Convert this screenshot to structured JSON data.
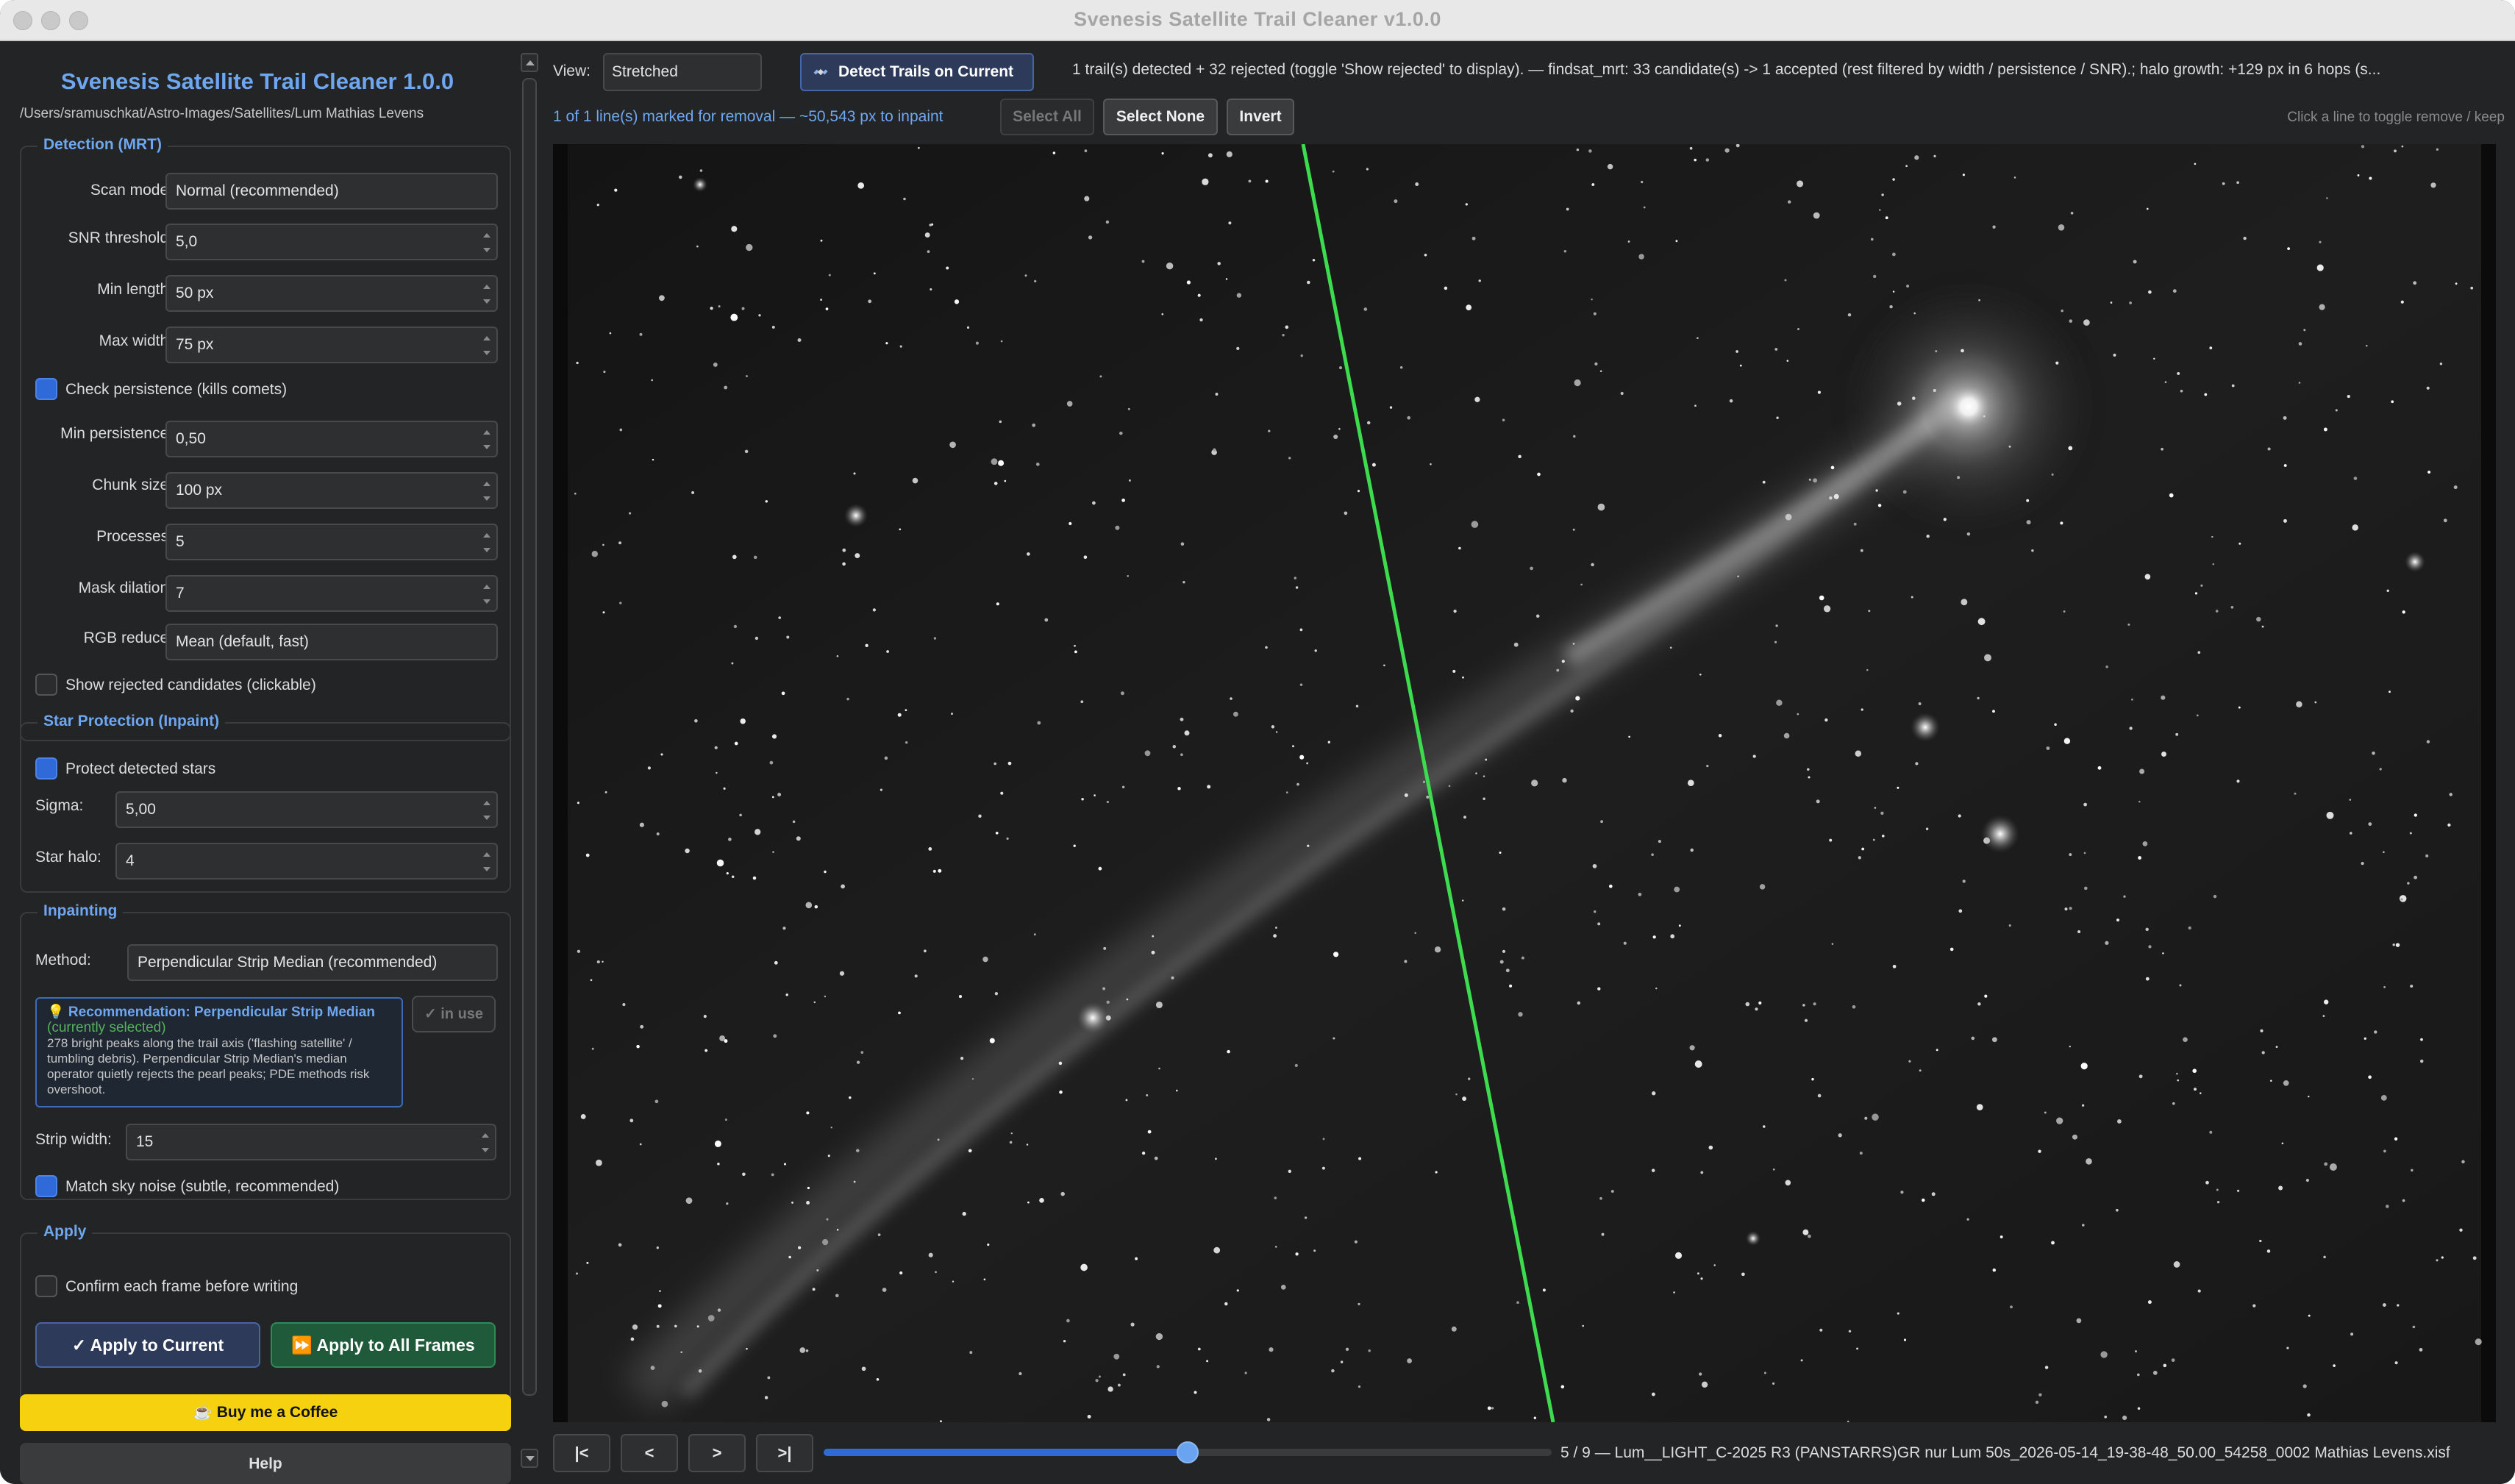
{
  "window": {
    "title": "Svenesis Satellite Trail Cleaner  v1.0.0"
  },
  "sidebar": {
    "app_title": "Svenesis Satellite Trail Cleaner 1.0.0",
    "path": "/Users/sramuschkat/Astro-Images/Satellites/Lum Mathias Levens",
    "detection": {
      "title": "Detection (MRT)",
      "scan_mode_label": "Scan mode:",
      "scan_mode_value": "Normal (recommended)",
      "snr_label": "SNR threshold:",
      "snr_value": "5,0",
      "min_length_label": "Min length:",
      "min_length_value": "50 px",
      "max_width_label": "Max width:",
      "max_width_value": "75 px",
      "persistence_check_label": "Check persistence (kills comets)",
      "persistence_checked": true,
      "min_persistence_label": "Min persistence:",
      "min_persistence_value": "0,50",
      "chunk_label": "Chunk size:",
      "chunk_value": "100 px",
      "processes_label": "Processes:",
      "processes_value": "5",
      "dilation_label": "Mask dilation:",
      "dilation_value": "7",
      "rgb_label": "RGB reduce:",
      "rgb_value": "Mean (default, fast)",
      "show_rejected_label": "Show rejected candidates (clickable)",
      "show_rejected_checked": false
    },
    "star": {
      "title": "Star Protection (Inpaint)",
      "protect_label": "Protect detected stars",
      "protect_checked": true,
      "sigma_label": "Sigma:",
      "sigma_value": "5,00",
      "halo_label": "Star halo:",
      "halo_value": "4"
    },
    "inpainting": {
      "title": "Inpainting",
      "method_label": "Method:",
      "method_value": "Perpendicular Strip Median (recommended)",
      "rec_title": "💡 Recommendation: Perpendicular Strip Median",
      "rec_sub": "(currently selected)",
      "rec_body": "278 bright peaks along the trail axis ('flashing satellite' / tumbling debris). Perpendicular Strip Median's median operator quietly rejects the pearl peaks; PDE methods risk overshoot.",
      "in_use_label": "✓ in use",
      "strip_label": "Strip width:",
      "strip_value": "15",
      "noise_label": "Match sky noise (subtle, recommended)",
      "noise_checked": true
    },
    "apply": {
      "title": "Apply",
      "confirm_label": "Confirm each frame before writing",
      "confirm_checked": false,
      "apply_current": "✓ Apply to Current",
      "apply_all": "⏩ Apply to All Frames"
    },
    "coffee_label": "☕ Buy me a Coffee",
    "help_label": "Help"
  },
  "toolbar": {
    "view_label": "View:",
    "view_value": "Stretched",
    "detect_label": "Detect Trails on Current",
    "status": "1 trail(s) detected  +  32 rejected (toggle 'Show rejected' to display).  —  findsat_mrt: 33 candidate(s) -> 1 accepted (rest filtered by width / persistence / SNR).; halo growth: +129 px in 6 hops (s...",
    "marked": "1 of 1 line(s) marked for removal  —  ~50,543 px to inpaint",
    "select_all": "Select All",
    "select_none": "Select None",
    "invert": "Invert",
    "hint": "Click a line to toggle remove / keep"
  },
  "navigator": {
    "first": "|<",
    "prev": "<",
    "next": ">",
    "last": ">|",
    "frame_index": 5,
    "frame_count": 9,
    "frame_text": "5 / 9  —  Lum__LIGHT_C-2025 R3 (PANSTARRS)GR nur Lum 50s_2026-05-14_19-38-48_50.00_54258_0002 Mathias Levens.xisf"
  },
  "colors": {
    "accent": "#6ea7f0",
    "trail_line": "#3ddc4f",
    "coffee": "#f5d10f",
    "apply_current_bg": "#2d3a5a",
    "apply_all_bg": "#1f5a3a"
  }
}
